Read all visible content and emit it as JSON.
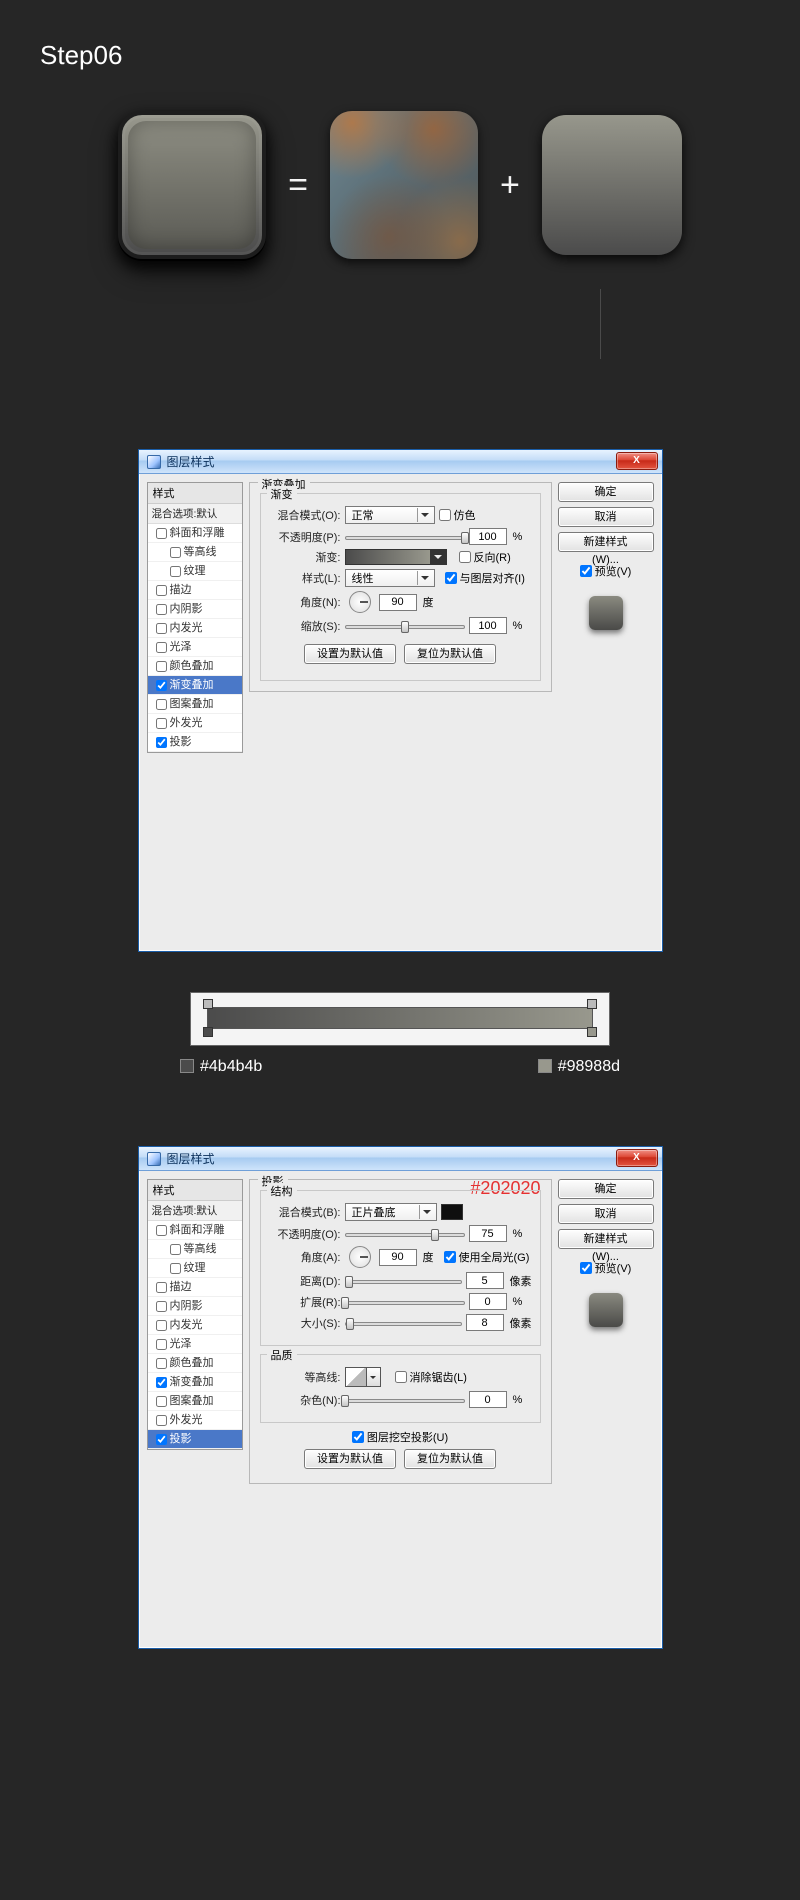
{
  "step_title": "Step06",
  "operators": {
    "equals": "=",
    "plus": "+"
  },
  "dialog1": {
    "title": "图层样式",
    "close": "X",
    "styles_header": "样式",
    "styles_sub": "混合选项:默认",
    "styles": [
      {
        "label": "斜面和浮雕",
        "checked": false
      },
      {
        "label": "等高线",
        "checked": false,
        "indent": true
      },
      {
        "label": "纹理",
        "checked": false,
        "indent": true
      },
      {
        "label": "描边",
        "checked": false
      },
      {
        "label": "内阴影",
        "checked": false
      },
      {
        "label": "内发光",
        "checked": false
      },
      {
        "label": "光泽",
        "checked": false
      },
      {
        "label": "颜色叠加",
        "checked": false
      },
      {
        "label": "渐变叠加",
        "checked": true,
        "selected": true
      },
      {
        "label": "图案叠加",
        "checked": false
      },
      {
        "label": "外发光",
        "checked": false
      },
      {
        "label": "投影",
        "checked": true
      }
    ],
    "panel_title": "渐变叠加",
    "sub_title": "渐变",
    "blend_label": "混合模式(O):",
    "blend_value": "正常",
    "dither_label": "仿色",
    "opacity_label": "不透明度(P):",
    "opacity_value": "100",
    "pct": "%",
    "grad_label": "渐变:",
    "reverse_label": "反向(R)",
    "style_label": "样式(L):",
    "style_value": "线性",
    "align_label": "与图层对齐(I)",
    "angle_label": "角度(N):",
    "angle_value": "90",
    "degree": "度",
    "scale_label": "缩放(S):",
    "scale_value": "100",
    "set_default": "设置为默认值",
    "reset_default": "复位为默认值",
    "ok": "确定",
    "cancel": "取消",
    "new_style": "新建样式(W)...",
    "preview": "预览(V)"
  },
  "grad_strip": {
    "color1": "#4b4b4b",
    "color2": "#98988d"
  },
  "dialog2": {
    "title": "图层样式",
    "close": "X",
    "styles_header": "样式",
    "styles_sub": "混合选项:默认",
    "styles": [
      {
        "label": "斜面和浮雕",
        "checked": false
      },
      {
        "label": "等高线",
        "checked": false,
        "indent": true
      },
      {
        "label": "纹理",
        "checked": false,
        "indent": true
      },
      {
        "label": "描边",
        "checked": false
      },
      {
        "label": "内阴影",
        "checked": false
      },
      {
        "label": "内发光",
        "checked": false
      },
      {
        "label": "光泽",
        "checked": false
      },
      {
        "label": "颜色叠加",
        "checked": false
      },
      {
        "label": "渐变叠加",
        "checked": true
      },
      {
        "label": "图案叠加",
        "checked": false
      },
      {
        "label": "外发光",
        "checked": false
      },
      {
        "label": "投影",
        "checked": true,
        "selected": true
      }
    ],
    "panel_title": "投影",
    "structure": "结构",
    "annotation": "#202020",
    "blend_label": "混合模式(B):",
    "blend_value": "正片叠底",
    "swatch_color": "#202020",
    "opacity_label": "不透明度(O):",
    "opacity_value": "75",
    "pct": "%",
    "angle_label": "角度(A):",
    "angle_value": "90",
    "degree": "度",
    "global_label": "使用全局光(G)",
    "distance_label": "距离(D):",
    "distance_value": "5",
    "px": "像素",
    "spread_label": "扩展(R):",
    "spread_value": "0",
    "size_label": "大小(S):",
    "size_value": "8",
    "quality": "品质",
    "contour_label": "等高线:",
    "antialias_label": "消除锯齿(L)",
    "noise_label": "杂色(N):",
    "noise_value": "0",
    "knockout_label": "图层挖空投影(U)",
    "set_default": "设置为默认值",
    "reset_default": "复位为默认值",
    "ok": "确定",
    "cancel": "取消",
    "new_style": "新建样式(W)...",
    "preview": "预览(V)"
  }
}
